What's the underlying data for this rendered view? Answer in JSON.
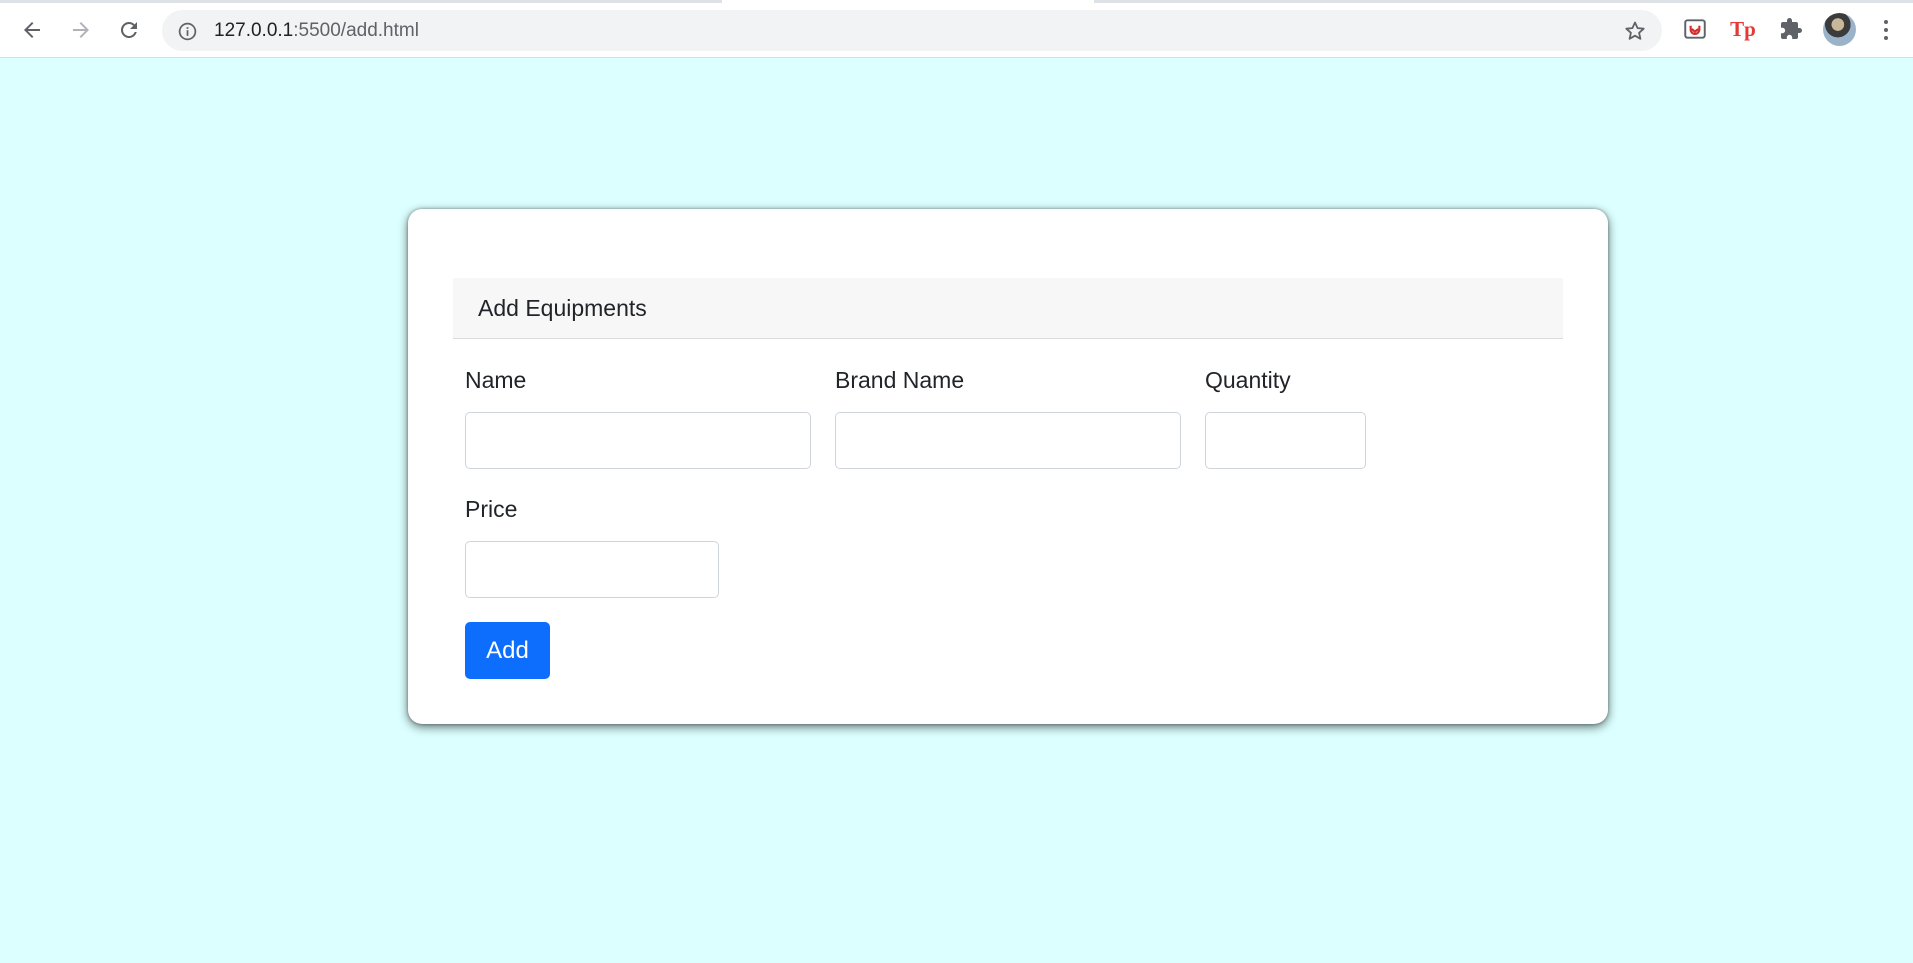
{
  "browser": {
    "url_host": "127.0.0.1",
    "url_path": ":5500/add.html",
    "icons": {
      "back": "arrow-left-icon",
      "forward": "arrow-right-icon",
      "reload": "reload-icon",
      "info": "info-icon",
      "bookmark": "star-icon",
      "extension_1": "pocket-icon",
      "extension_2": "tp-icon",
      "extensions": "puzzle-icon",
      "menu": "kebab-icon"
    },
    "extension_2_label": "Tp"
  },
  "form": {
    "header": "Add Equipments",
    "fields": {
      "name": {
        "label": "Name",
        "value": ""
      },
      "brand_name": {
        "label": "Brand Name",
        "value": ""
      },
      "quantity": {
        "label": "Quantity",
        "value": ""
      },
      "price": {
        "label": "Price",
        "value": ""
      }
    },
    "submit_label": "Add"
  },
  "colors": {
    "page_background": "#dcffff",
    "primary_button": "#0d6efd",
    "card_header_bg": "#f7f7f7"
  }
}
